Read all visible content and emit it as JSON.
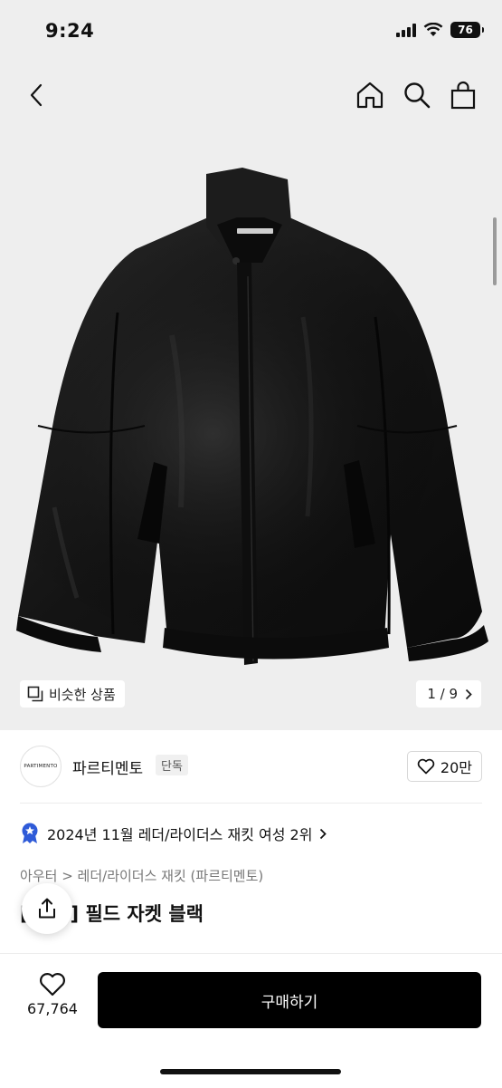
{
  "status_bar": {
    "time": "9:24",
    "battery": "76"
  },
  "hero": {
    "similar_label": "비슷한 상품",
    "counter": "1 / 9"
  },
  "brand": {
    "logo_text": "PARTIMENTO",
    "name": "파르티멘토",
    "badge": "단독",
    "likes": "20만"
  },
  "ranking": {
    "text": "2024년 11월 레더/라이더스 재킷 여성 2위"
  },
  "breadcrumb": {
    "category": "아우터",
    "separator": ">",
    "subcategory": "레더/라이더스 재킷 (파르티멘토)"
  },
  "product": {
    "title": "[   레더] 필드 자켓 블랙"
  },
  "bottom": {
    "wish_count": "67,764",
    "buy_label": "구매하기"
  },
  "colors": {
    "accent": "#000000",
    "background_gray": "#eeeeee",
    "badge_blue": "#2f5bd8"
  }
}
